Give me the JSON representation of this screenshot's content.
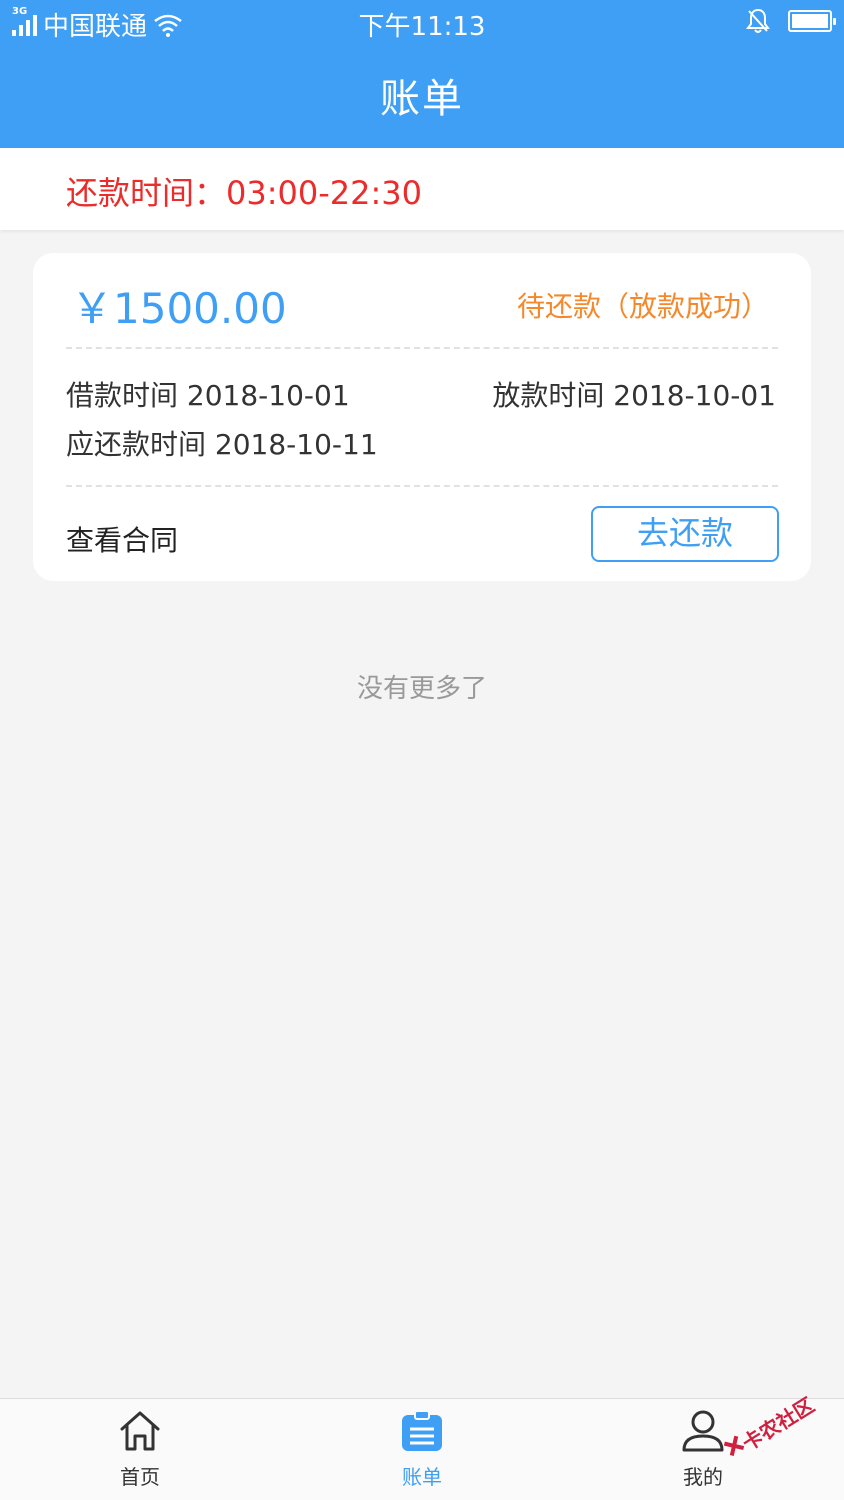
{
  "status_bar": {
    "network": "3G",
    "carrier": "中国联通",
    "time": "下午11:13"
  },
  "header": {
    "title": "账单"
  },
  "notice": {
    "repay_time": "还款时间：03:00-22:30"
  },
  "bill": {
    "amount": "￥1500.00",
    "status": "待还款（放款成功）",
    "loan_date_label": "借款时间",
    "loan_date": "2018-10-01",
    "disburse_date_label": "放款时间",
    "disburse_date": "2018-10-01",
    "due_date_label": "应还款时间",
    "due_date": "2018-10-11",
    "contract_link": "查看合同",
    "repay_button": "去还款"
  },
  "list_end": "没有更多了",
  "tabbar": {
    "items": [
      {
        "label": "首页",
        "icon": "home-icon",
        "active": false
      },
      {
        "label": "账单",
        "icon": "bill-icon",
        "active": true
      },
      {
        "label": "我的",
        "icon": "user-icon",
        "active": false
      }
    ]
  },
  "watermark": "卡农社区",
  "colors": {
    "primary": "#3f9ff5",
    "notice_red": "#ec2b2b",
    "status_orange": "#f5882b",
    "background": "#f4f4f4"
  }
}
